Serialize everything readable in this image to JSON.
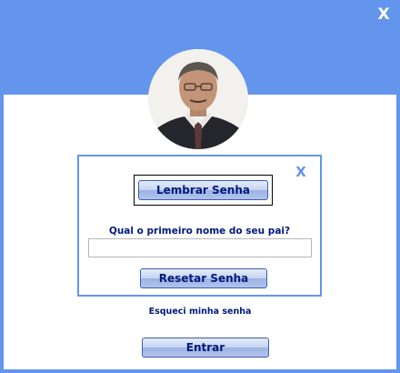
{
  "window": {
    "close_label": "X"
  },
  "recovery_dialog": {
    "close_label": "X",
    "remember_button_label": "Lembrar Senha",
    "security_question": "Qual o primeiro nome do seu pai?",
    "answer_value": "",
    "answer_placeholder": "",
    "reset_button_label": "Resetar Senha"
  },
  "forgot_password_link": "Esqueci minha senha",
  "login_button_label": "Entrar",
  "colors": {
    "accent": "#6495ed",
    "button_text": "#001a7a",
    "background": "#ffffff"
  },
  "avatar": {
    "icon": "user-photo"
  }
}
